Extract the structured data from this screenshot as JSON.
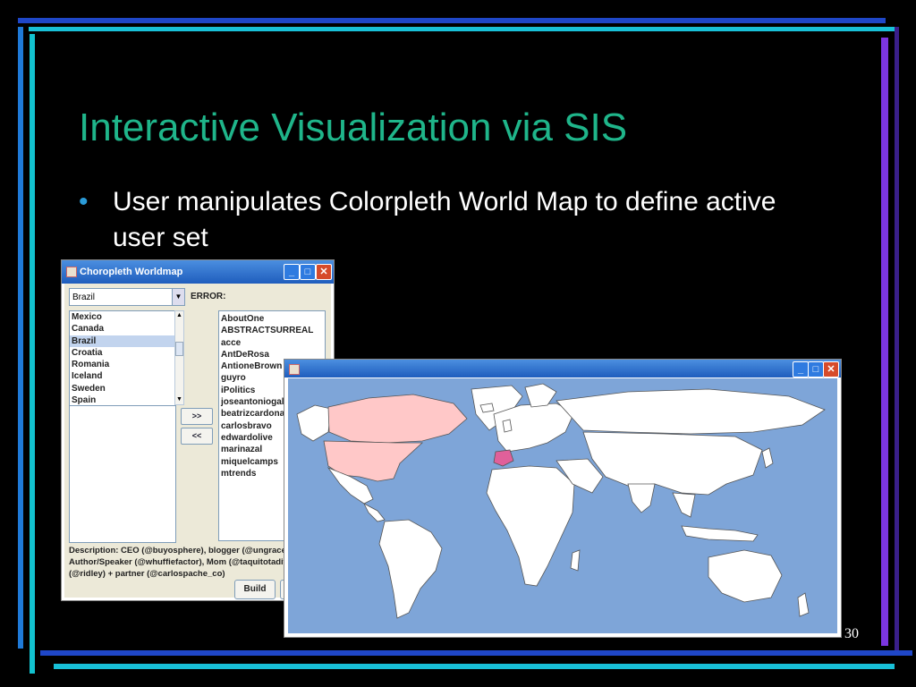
{
  "slide": {
    "title": "Interactive Visualization via SIS",
    "bullet": "User manipulates Colorpleth World Map to define active user set",
    "page_number": "30",
    "title_color": "#1fb58a"
  },
  "window1": {
    "title": "Choropleth Worldmap",
    "combo_value": "Brazil",
    "error_label": "ERROR:",
    "country_list": [
      "Mexico",
      "Canada",
      "Brazil",
      "Croatia",
      "Romania",
      "Iceland",
      "Sweden",
      "Spain"
    ],
    "selected_country": "Brazil",
    "add_button": ">>",
    "remove_button": "<<",
    "users": [
      "AboutOne",
      "ABSTRACTSURREAL",
      "acce",
      "AntDeRosa",
      "AntioneBrown",
      "guyro",
      "iPolitics",
      "joseantoniogall",
      "beatrizcardona",
      "carlosbravo",
      "edwardolive",
      "marinazal",
      "miquelcamps",
      "mtrends"
    ],
    "description_lines": [
      "Description: CEO (@buyosphere), blogger (@ungracefully",
      "Author/Speaker (@whuffiefactor), Mom (@taquitotadito),",
      "(@ridley) + partner (@carlospache_co)"
    ],
    "build_button": "Build"
  },
  "window2": {
    "title": "",
    "map_colors": {
      "ocean": "#7ea5d8",
      "land": "#ffffff",
      "highlight_light": "#ffc8c8",
      "highlight_strong": "#e0609a"
    }
  }
}
